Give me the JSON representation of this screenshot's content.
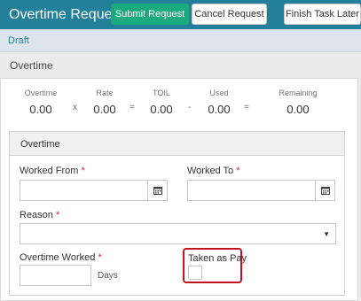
{
  "header": {
    "title": "Overtime Request",
    "buttons": {
      "submit": "Submit Request",
      "cancel": "Cancel Request",
      "finish": "Finish Task Later"
    }
  },
  "status": {
    "label": "Draft"
  },
  "section": {
    "title": "Overtime"
  },
  "summary": {
    "items": [
      {
        "label": "Overtime",
        "value": "0.00"
      },
      {
        "label": "Rate",
        "value": "0.00"
      },
      {
        "label": "TOIL",
        "value": "0.00"
      },
      {
        "label": "Used",
        "value": "0.00"
      },
      {
        "label": "Remaining",
        "value": "0.00"
      }
    ],
    "operators": [
      "x",
      "=",
      "-",
      "="
    ]
  },
  "form": {
    "card_title": "Overtime",
    "worked_from": {
      "label": "Worked From",
      "value": ""
    },
    "worked_to": {
      "label": "Worked To",
      "value": ""
    },
    "reason": {
      "label": "Reason",
      "value": ""
    },
    "overtime_worked": {
      "label": "Overtime Worked",
      "value": "",
      "unit": "Days"
    },
    "taken_as_pay": {
      "label": "Taken as Pay",
      "checked": false
    },
    "required_marker": "*"
  },
  "colors": {
    "header_bg": "#22809a",
    "submit_bg": "#1aab7c",
    "required": "#d9232d",
    "highlight": "#c3121b"
  }
}
